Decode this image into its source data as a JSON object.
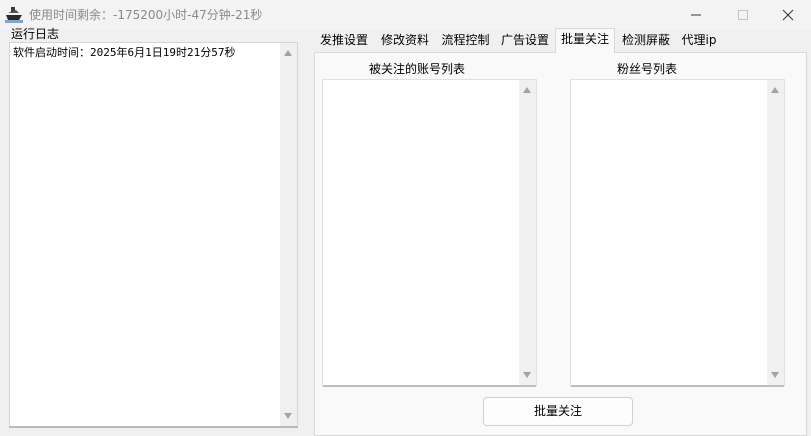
{
  "window": {
    "title": "使用时间剩余：-175200小时-47分钟-21秒",
    "icons": {
      "app": "ship-icon",
      "minimize": "minimize-icon",
      "maximize": "maximize-icon",
      "close": "close-icon"
    }
  },
  "log_panel": {
    "label": "运行日志",
    "lines": [
      "软件启动时间：2025年6月1日19时21分57秒"
    ]
  },
  "tabs": [
    {
      "label": "发推设置",
      "active": false
    },
    {
      "label": "修改资料",
      "active": false
    },
    {
      "label": "流程控制",
      "active": false
    },
    {
      "label": "广告设置",
      "active": false
    },
    {
      "label": "批量关注",
      "active": true
    },
    {
      "label": "检测屏蔽",
      "active": false
    },
    {
      "label": "代理ip",
      "active": false
    }
  ],
  "batch_follow": {
    "followed_accounts_label": "被关注的账号列表",
    "followers_label": "粉丝号列表",
    "followed_accounts": [],
    "followers": [],
    "button_label": "批量关注"
  }
}
